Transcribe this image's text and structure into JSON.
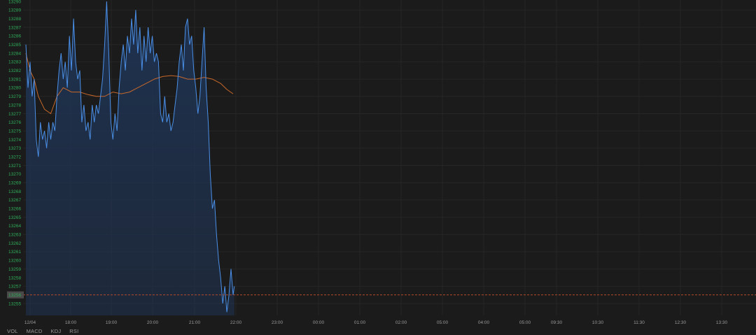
{
  "chart_data": {
    "type": "area",
    "ylim": [
      13254,
      13290
    ],
    "y_ticks": [
      13255,
      13256,
      13257,
      13258,
      13259,
      13260,
      13261,
      13262,
      13263,
      13264,
      13265,
      13266,
      13267,
      13268,
      13269,
      13270,
      13271,
      13272,
      13273,
      13274,
      13275,
      13276,
      13277,
      13278,
      13279,
      13280,
      13281,
      13282,
      13283,
      13284,
      13285,
      13286,
      13287,
      13288,
      13289,
      13290
    ],
    "x_tick_labels": [
      "12/04",
      "18:00",
      "19:00",
      "20:00",
      "21:00",
      "22:00",
      "23:00",
      "00:00",
      "01:00",
      "02:00",
      "05:00",
      "04:00",
      "05:00",
      "09:30",
      "10:30",
      "11:30",
      "12:30",
      "13:30"
    ],
    "current_price": 13256,
    "current_price_label": "13256",
    "price_series": [
      [
        0,
        13285
      ],
      [
        0.05,
        13280
      ],
      [
        0.1,
        13283
      ],
      [
        0.15,
        13279
      ],
      [
        0.2,
        13281
      ],
      [
        0.25,
        13274
      ],
      [
        0.3,
        13272
      ],
      [
        0.35,
        13276
      ],
      [
        0.4,
        13274
      ],
      [
        0.45,
        13275
      ],
      [
        0.5,
        13273
      ],
      [
        0.55,
        13276
      ],
      [
        0.6,
        13274
      ],
      [
        0.65,
        13276
      ],
      [
        0.7,
        13275
      ],
      [
        0.75,
        13279
      ],
      [
        0.8,
        13282
      ],
      [
        0.85,
        13284
      ],
      [
        0.9,
        13281
      ],
      [
        0.95,
        13283
      ],
      [
        1.0,
        13280
      ],
      [
        1.05,
        13286
      ],
      [
        1.1,
        13282
      ],
      [
        1.15,
        13288
      ],
      [
        1.2,
        13283
      ],
      [
        1.25,
        13281
      ],
      [
        1.3,
        13282
      ],
      [
        1.35,
        13276
      ],
      [
        1.4,
        13278
      ],
      [
        1.45,
        13275
      ],
      [
        1.5,
        13276
      ],
      [
        1.55,
        13274
      ],
      [
        1.6,
        13278
      ],
      [
        1.65,
        13276
      ],
      [
        1.7,
        13278
      ],
      [
        1.75,
        13277
      ],
      [
        1.8,
        13279
      ],
      [
        1.85,
        13281
      ],
      [
        1.9,
        13285
      ],
      [
        1.95,
        13290
      ],
      [
        2.0,
        13284
      ],
      [
        2.05,
        13276
      ],
      [
        2.1,
        13274
      ],
      [
        2.15,
        13277
      ],
      [
        2.2,
        13275
      ],
      [
        2.25,
        13280
      ],
      [
        2.3,
        13283
      ],
      [
        2.35,
        13285
      ],
      [
        2.4,
        13282
      ],
      [
        2.45,
        13286
      ],
      [
        2.5,
        13284
      ],
      [
        2.55,
        13288
      ],
      [
        2.6,
        13285
      ],
      [
        2.65,
        13289
      ],
      [
        2.7,
        13284
      ],
      [
        2.75,
        13287
      ],
      [
        2.8,
        13282
      ],
      [
        2.85,
        13286
      ],
      [
        2.9,
        13283
      ],
      [
        2.95,
        13287
      ],
      [
        3.0,
        13284
      ],
      [
        3.05,
        13286
      ],
      [
        3.1,
        13283
      ],
      [
        3.15,
        13284
      ],
      [
        3.2,
        13283
      ],
      [
        3.25,
        13277
      ],
      [
        3.3,
        13276
      ],
      [
        3.35,
        13279
      ],
      [
        3.4,
        13276
      ],
      [
        3.45,
        13277
      ],
      [
        3.5,
        13275
      ],
      [
        3.55,
        13276
      ],
      [
        3.6,
        13278
      ],
      [
        3.65,
        13280
      ],
      [
        3.7,
        13283
      ],
      [
        3.75,
        13285
      ],
      [
        3.8,
        13282
      ],
      [
        3.85,
        13287
      ],
      [
        3.9,
        13288
      ],
      [
        3.95,
        13285
      ],
      [
        4.0,
        13286
      ],
      [
        4.05,
        13282
      ],
      [
        4.1,
        13280
      ],
      [
        4.15,
        13277
      ],
      [
        4.2,
        13279
      ],
      [
        4.25,
        13283
      ],
      [
        4.3,
        13287
      ],
      [
        4.35,
        13280
      ],
      [
        4.4,
        13276
      ],
      [
        4.45,
        13270
      ],
      [
        4.5,
        13266
      ],
      [
        4.55,
        13267
      ],
      [
        4.6,
        13263
      ],
      [
        4.65,
        13260
      ],
      [
        4.7,
        13258
      ],
      [
        4.75,
        13255
      ],
      [
        4.8,
        13257
      ],
      [
        4.85,
        13254
      ],
      [
        4.9,
        13256
      ],
      [
        4.95,
        13259
      ],
      [
        5.0,
        13256
      ],
      [
        5.03,
        13257
      ]
    ],
    "ma_series": [
      [
        0,
        13284
      ],
      [
        0.1,
        13282
      ],
      [
        0.2,
        13281
      ],
      [
        0.3,
        13279
      ],
      [
        0.45,
        13277.5
      ],
      [
        0.6,
        13277
      ],
      [
        0.75,
        13279
      ],
      [
        0.9,
        13280
      ],
      [
        1.1,
        13279.5
      ],
      [
        1.3,
        13279.5
      ],
      [
        1.5,
        13279.2
      ],
      [
        1.7,
        13279
      ],
      [
        1.9,
        13279
      ],
      [
        2.1,
        13279.5
      ],
      [
        2.3,
        13279.3
      ],
      [
        2.5,
        13279.5
      ],
      [
        2.7,
        13280
      ],
      [
        2.9,
        13280.5
      ],
      [
        3.1,
        13281
      ],
      [
        3.3,
        13281.3
      ],
      [
        3.5,
        13281.4
      ],
      [
        3.7,
        13281.3
      ],
      [
        3.9,
        13281
      ],
      [
        4.1,
        13281
      ],
      [
        4.3,
        13281.2
      ],
      [
        4.5,
        13281
      ],
      [
        4.7,
        13280.5
      ],
      [
        4.85,
        13279.8
      ],
      [
        5.0,
        13279.3
      ]
    ]
  },
  "indicator_tabs": [
    "VOL",
    "MACD",
    "KDJ",
    "RSI"
  ],
  "colors": {
    "background": "#1b1b1b",
    "price_line": "#4a8fe7",
    "price_fill": "#1f3352",
    "ma_line": "#c8682a",
    "price_axis_text": "#2fae5a",
    "time_axis_text": "#9a9a9a",
    "current_price_line": "#b04a2a"
  }
}
